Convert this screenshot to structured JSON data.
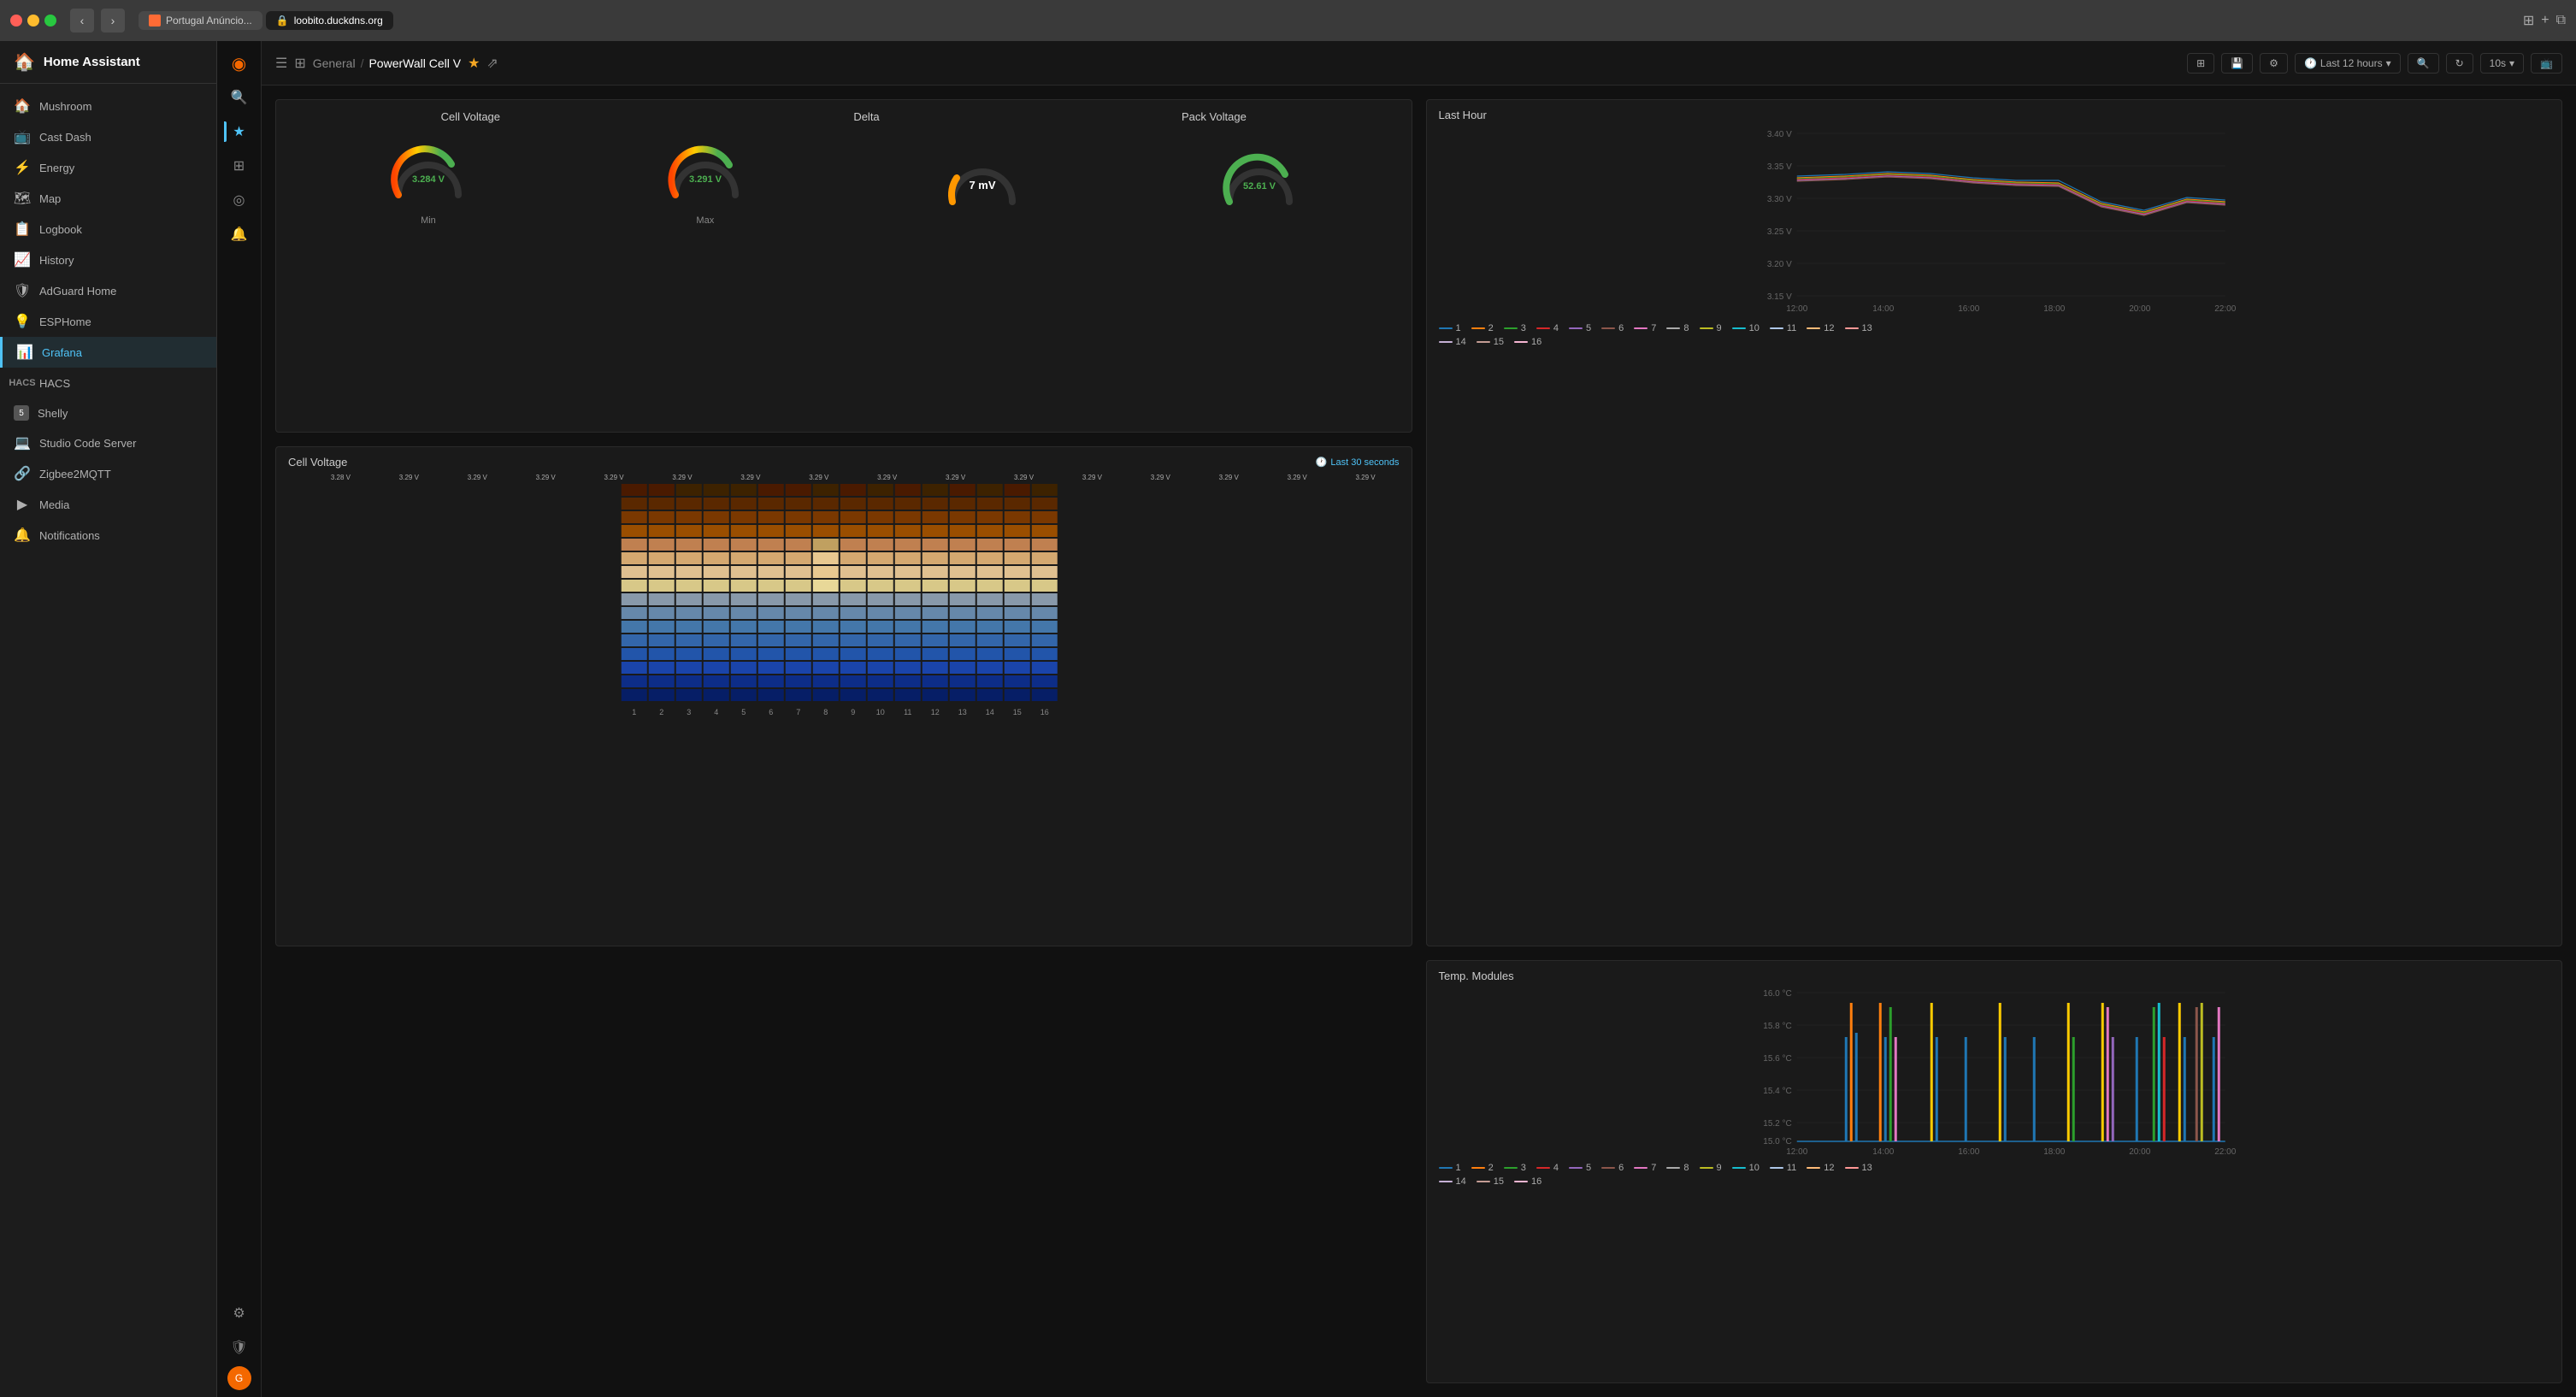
{
  "browser": {
    "tabs": [
      {
        "id": "tab1",
        "label": "Portugal Anúncio...",
        "icon": "🔒",
        "active": false
      },
      {
        "id": "tab2",
        "label": "loobito.duckdns.org",
        "icon": "🔒",
        "active": true
      }
    ],
    "url": "loobito.duckdns.org"
  },
  "sidebar": {
    "title": "Home Assistant",
    "items": [
      {
        "id": "mushroom",
        "label": "Mushroom",
        "icon": "🏠"
      },
      {
        "id": "cast-dash",
        "label": "Cast Dash",
        "icon": "📺"
      },
      {
        "id": "energy",
        "label": "Energy",
        "icon": "⚡"
      },
      {
        "id": "map",
        "label": "Map",
        "icon": "🗺"
      },
      {
        "id": "logbook",
        "label": "Logbook",
        "icon": "📋"
      },
      {
        "id": "history",
        "label": "History",
        "icon": "📈"
      },
      {
        "id": "adguard",
        "label": "AdGuard Home",
        "icon": "🛡"
      },
      {
        "id": "esphome",
        "label": "ESPHome",
        "icon": "💡"
      },
      {
        "id": "grafana",
        "label": "Grafana",
        "icon": "📊",
        "active": true
      },
      {
        "id": "hacs",
        "label": "HACS",
        "icon": "🔧"
      },
      {
        "id": "shelly",
        "label": "Shelly",
        "icon": "5"
      },
      {
        "id": "studio",
        "label": "Studio Code Server",
        "icon": "💻"
      },
      {
        "id": "zigbee",
        "label": "Zigbee2MQTT",
        "icon": "🔗"
      },
      {
        "id": "media",
        "label": "Media",
        "icon": "▶"
      },
      {
        "id": "notifications",
        "label": "Notifications",
        "icon": "🔔"
      }
    ]
  },
  "icon_sidebar": {
    "items": [
      {
        "id": "menu",
        "icon": "☰",
        "active": false
      },
      {
        "id": "search",
        "icon": "🔍",
        "active": false
      },
      {
        "id": "star",
        "icon": "★",
        "active": true
      },
      {
        "id": "dashboards",
        "icon": "⊞",
        "active": false
      },
      {
        "id": "compass",
        "icon": "◎",
        "active": false
      },
      {
        "id": "alerts",
        "icon": "🔔",
        "active": false
      },
      {
        "id": "settings",
        "icon": "⚙",
        "active": false
      },
      {
        "id": "shield",
        "icon": "🛡",
        "active": false
      },
      {
        "id": "grafana-logo",
        "icon": "◉",
        "active": false
      }
    ]
  },
  "topbar": {
    "breadcrumb_parent": "General",
    "breadcrumb_separator": "/",
    "breadcrumb_current": "PowerWall Cell V",
    "time_range": "Last 12 hours",
    "refresh": "10s",
    "buttons": {
      "add_panel": "Add panel",
      "save_dashboard": "Save dashboard",
      "dashboard_settings": "Dashboard settings",
      "zoom_out": "Zoom out",
      "refresh": "Refresh",
      "tv_mode": "TV mode"
    }
  },
  "cell_voltage": {
    "title": "Cell Voltage",
    "min_label": "Min",
    "max_label": "Max",
    "min_value": "3.284 V",
    "max_value": "3.291 V",
    "gauges": [
      {
        "id": "min",
        "value": 3.284,
        "max": 3.4,
        "min": 3.1,
        "display": "3.284 V",
        "color": "#4caf50"
      },
      {
        "id": "max",
        "value": 3.291,
        "max": 3.4,
        "min": 3.1,
        "display": "3.291 V",
        "color": "#4caf50"
      }
    ]
  },
  "delta": {
    "title": "Delta",
    "value": "7 mV"
  },
  "pack_voltage": {
    "title": "Pack Voltage",
    "value": "52.61 V"
  },
  "last_hour_chart": {
    "title": "Last Hour",
    "y_axis": [
      "3.40 V",
      "3.35 V",
      "3.30 V",
      "3.25 V",
      "3.20 V",
      "3.15 V"
    ],
    "x_axis": [
      "12:00",
      "14:00",
      "16:00",
      "18:00",
      "20:00",
      "22:00"
    ],
    "legend": [
      {
        "id": 1,
        "color": "#1f77b4"
      },
      {
        "id": 2,
        "color": "#ff7f0e"
      },
      {
        "id": 3,
        "color": "#2ca02c"
      },
      {
        "id": 4,
        "color": "#d62728"
      },
      {
        "id": 5,
        "color": "#9467bd"
      },
      {
        "id": 6,
        "color": "#8c564b"
      },
      {
        "id": 7,
        "color": "#e377c2"
      },
      {
        "id": 8,
        "color": "#7f7f7f"
      },
      {
        "id": 9,
        "color": "#bcbd22"
      },
      {
        "id": 10,
        "color": "#17becf"
      },
      {
        "id": 11,
        "color": "#aec7e8"
      },
      {
        "id": 12,
        "color": "#ffbb78"
      },
      {
        "id": 13,
        "color": "#ff9896"
      },
      {
        "id": 14,
        "color": "#c5b0d5"
      },
      {
        "id": 15,
        "color": "#c49c94"
      },
      {
        "id": 16,
        "color": "#f7b6d2"
      }
    ]
  },
  "cell_voltage_heatmap": {
    "title": "Cell Voltage",
    "time_label": "Last 30 seconds",
    "top_values": [
      "3.28 V",
      "3.29 V",
      "3.29 V",
      "3.29 V",
      "3.29 V",
      "3.29 V",
      "3.29 V",
      "3.29 V",
      "3.29 V",
      "3.29 V",
      "3.29 V",
      "3.29 V",
      "3.29 V",
      "3.29 V",
      "3.29 V",
      "3.29 V"
    ],
    "x_labels": [
      "1",
      "2",
      "3",
      "4",
      "5",
      "6",
      "7",
      "8",
      "9",
      "10",
      "11",
      "12",
      "13",
      "14",
      "15",
      "16"
    ],
    "rows": 20
  },
  "temp_modules": {
    "title": "Temp. Modules",
    "y_axis": [
      "16.0 °C",
      "15.8 °C",
      "15.6 °C",
      "15.4 °C",
      "15.2 °C",
      "15.0 °C"
    ],
    "x_axis": [
      "12:00",
      "14:00",
      "16:00",
      "18:00",
      "20:00",
      "22:00"
    ],
    "legend": [
      {
        "id": 1,
        "color": "#1f77b4"
      },
      {
        "id": 2,
        "color": "#ff7f0e"
      },
      {
        "id": 3,
        "color": "#2ca02c"
      },
      {
        "id": 4,
        "color": "#d62728"
      },
      {
        "id": 5,
        "color": "#9467bd"
      },
      {
        "id": 6,
        "color": "#8c564b"
      },
      {
        "id": 7,
        "color": "#e377c2"
      },
      {
        "id": 8,
        "color": "#7f7f7f"
      },
      {
        "id": 9,
        "color": "#bcbd22"
      },
      {
        "id": 10,
        "color": "#17becf"
      },
      {
        "id": 11,
        "color": "#aec7e8"
      },
      {
        "id": 12,
        "color": "#ffbb78"
      },
      {
        "id": 13,
        "color": "#ff9896"
      },
      {
        "id": 14,
        "color": "#c5b0d5"
      },
      {
        "id": 15,
        "color": "#c49c94"
      },
      {
        "id": 16,
        "color": "#f7b6d2"
      }
    ]
  }
}
